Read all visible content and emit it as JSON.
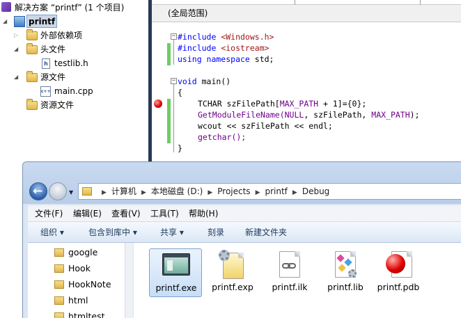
{
  "solution": {
    "title": "解决方案 “printf” (1 个项目)",
    "project": "printf",
    "items": [
      {
        "label": "外部依赖项"
      },
      {
        "label": "头文件"
      },
      {
        "label": "testlib.h"
      },
      {
        "label": "源文件"
      },
      {
        "label": "main.cpp"
      },
      {
        "label": "资源文件"
      }
    ],
    "file_icon_h": "h",
    "file_icon_cpp": "c++"
  },
  "editor": {
    "scope": "(全局范围)",
    "lines": [
      {
        "a": "#include ",
        "b": "<Windows.h>"
      },
      {
        "a": "#include ",
        "b": "<iostream>"
      },
      {
        "a": "using namespace ",
        "b": "std;"
      },
      {
        "a": "void ",
        "b": "main()"
      },
      {
        "a": "{"
      },
      {
        "a": "TCHAR szFilePath[",
        "b": "MAX_PATH",
        "c": " + 1]={0};"
      },
      {
        "a": "GetModuleFileName(",
        "b": "NULL",
        "c": ", szFilePath, ",
        "d": "MAX_PATH",
        "e": ");"
      },
      {
        "a": "wcout << szFilePath << endl;"
      },
      {
        "a": "getchar();"
      },
      {
        "a": "}"
      }
    ]
  },
  "explorer": {
    "breadcrumbs": [
      "计算机",
      "本地磁盘 (D:)",
      "Projects",
      "printf",
      "Debug"
    ],
    "menus": [
      "文件(F)",
      "编辑(E)",
      "查看(V)",
      "工具(T)",
      "帮助(H)"
    ],
    "toolbar": [
      "组织 ▾",
      "包含到库中 ▾",
      "共享 ▾",
      "刻录",
      "新建文件夹"
    ],
    "nav_items": [
      "google",
      "Hook",
      "HookNote",
      "html",
      "htmltest"
    ],
    "files": [
      {
        "name": "printf.exe",
        "icon": "exe-window-icon",
        "selected": true
      },
      {
        "name": "printf.exp",
        "icon": "exp-gear-doc-icon"
      },
      {
        "name": "printf.ilk",
        "icon": "ilk-link-doc-icon"
      },
      {
        "name": "printf.lib",
        "icon": "lib-shapes-doc-icon"
      },
      {
        "name": "printf.pdb",
        "icon": "pdb-red-ball-icon"
      }
    ]
  },
  "colors": {
    "divider": "#293955",
    "green_margin": "#6ccd62",
    "keyword": "#0000ff",
    "include_string": "#a31515",
    "macro": "#6f008a",
    "breakpoint": "#d30000"
  }
}
